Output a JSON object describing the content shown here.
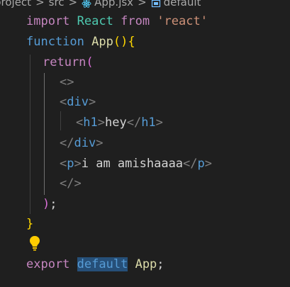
{
  "breadcrumb": {
    "items": [
      "project",
      "src",
      "App.jsx",
      "default"
    ],
    "separator": ">"
  },
  "code": {
    "line1": {
      "import": "import",
      "react": "React",
      "from": "from",
      "module": "'react'"
    },
    "line2": {
      "function": "function",
      "name": "App",
      "parens": "()",
      "brace": "{"
    },
    "line3": {
      "return": "return",
      "paren": "("
    },
    "line4": {
      "fragment_open": "<>"
    },
    "line5": {
      "lt": "<",
      "tag": "div",
      "gt": ">"
    },
    "line6": {
      "open_lt": "<",
      "tag": "h1",
      "open_gt": ">",
      "text": "hey",
      "close_lt": "</",
      "close_tag": "h1",
      "close_gt": ">"
    },
    "line7": {
      "lt": "</",
      "tag": "div",
      "gt": ">"
    },
    "line8": {
      "open_lt": "<",
      "tag": "p",
      "open_gt": ">",
      "text": "i am amishaaaa",
      "close_lt": "</",
      "close_tag": "p",
      "close_gt": ">"
    },
    "line9": {
      "fragment_close": "</>"
    },
    "line10": {
      "paren": ")",
      "semi": ";"
    },
    "line11": {
      "brace": "}"
    },
    "line13": {
      "export": "export",
      "default": "default",
      "name": "App",
      "semi": ";"
    }
  },
  "icons": {
    "lightbulb": "lightbulb-icon",
    "react": "react-icon",
    "symbol": "symbol-icon"
  },
  "colors": {
    "background": "#1f1f1f",
    "keyword_purple": "#c586c0",
    "keyword_blue": "#569cd6",
    "function_yellow": "#dcdcaa",
    "type_teal": "#4ec9b0",
    "string_orange": "#ce9178",
    "bracket_gold": "#ffd700",
    "bracket_pink": "#da70d6",
    "selection_highlight": "#264f78",
    "lightbulb": "#ffcc00"
  }
}
